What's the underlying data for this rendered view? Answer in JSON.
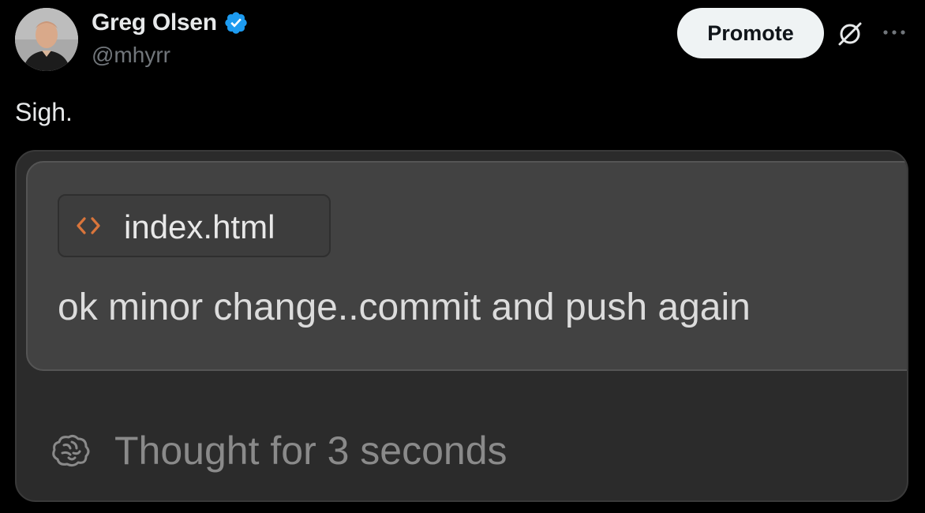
{
  "author": {
    "display_name": "Greg Olsen",
    "handle": "@mhyrr",
    "verified": true,
    "avatar_icon": "profile-photo"
  },
  "header_actions": {
    "promote_label": "Promote",
    "grok_icon": "grok-icon",
    "more_icon": "more-icon"
  },
  "tweet": {
    "text": "Sigh."
  },
  "media": {
    "file_chip": {
      "icon": "code-icon",
      "file_name": "index.html"
    },
    "prompt_text": "ok minor change..commit and push again",
    "thought": {
      "icon": "brain-icon",
      "text": "Thought for 3 seconds"
    }
  },
  "colors": {
    "background": "#000000",
    "verified_badge": "#1d9bf0",
    "code_icon": "#d9753b",
    "promote_bg": "#eff3f4"
  }
}
